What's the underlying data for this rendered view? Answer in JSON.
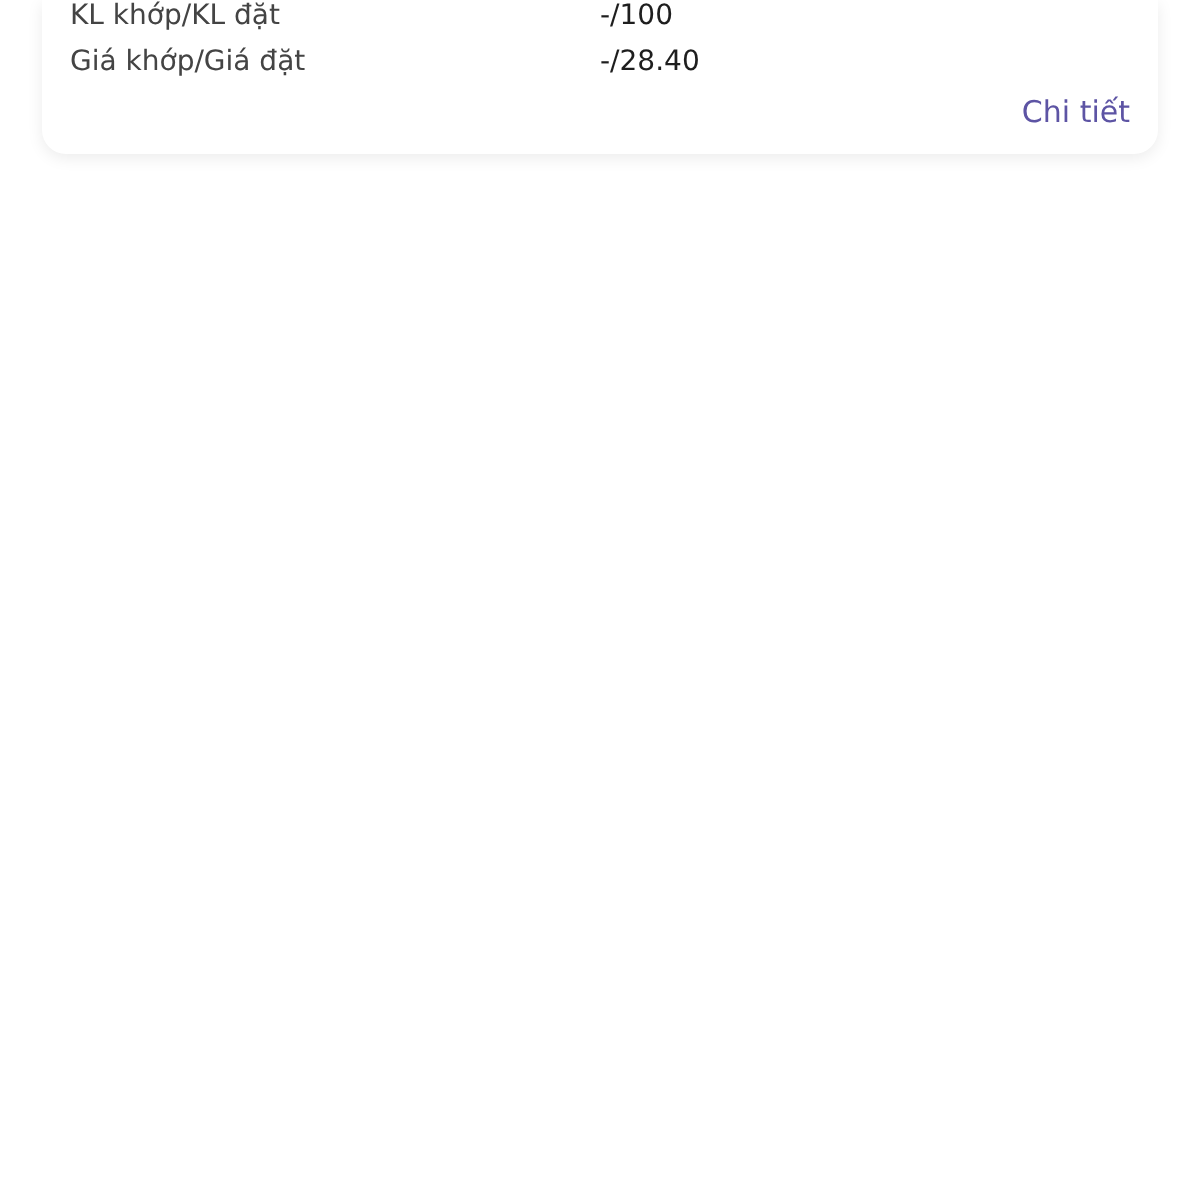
{
  "order_card": {
    "rows": [
      {
        "label": "KL khớp/KL đặt",
        "value": "-/100"
      },
      {
        "label": "Giá khớp/Giá đặt",
        "value": "-/28.40"
      }
    ],
    "detail_link": "Chi tiết"
  }
}
